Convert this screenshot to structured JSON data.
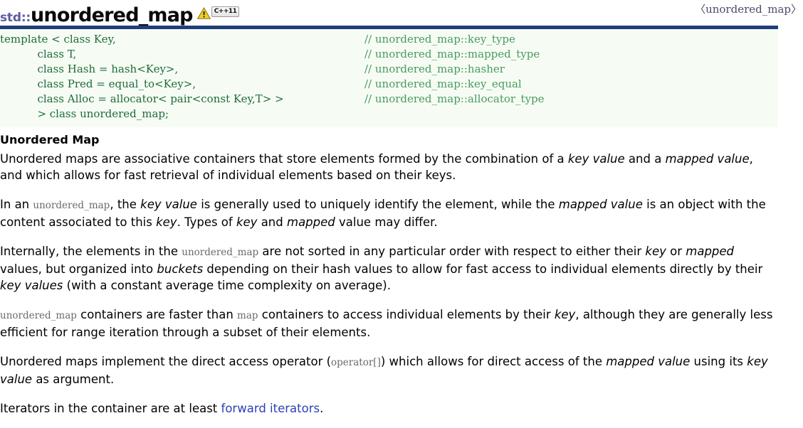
{
  "header": {
    "namespace_prefix": "std::",
    "class_name": "unordered_map",
    "warning_icon": "warning-triangle-icon",
    "standard_badge": "C++11",
    "include_header": "〈unordered_map〉"
  },
  "code_block": {
    "lines": [
      {
        "decl": "template < class Key,",
        "comment": "// unordered_map::key_type"
      },
      {
        "decl": "           class T,",
        "comment": "// unordered_map::mapped_type"
      },
      {
        "decl": "           class Hash = hash<Key>,",
        "comment": "// unordered_map::hasher"
      },
      {
        "decl": "           class Pred = equal_to<Key>,",
        "comment": "// unordered_map::key_equal"
      },
      {
        "decl": "           class Alloc = allocator< pair<const Key,T> >",
        "comment": "// unordered_map::allocator_type"
      },
      {
        "decl": "           > class unordered_map;",
        "comment": ""
      }
    ]
  },
  "content": {
    "section_title": "Unordered Map",
    "p1": {
      "t1": "Unordered maps are associative containers that store elements formed by the combination of a ",
      "em1": "key value",
      "t2": " and a ",
      "em2": "mapped value",
      "t3": ", and which allows for fast retrieval of individual elements based on their keys."
    },
    "p2": {
      "t1": "In an ",
      "code1": "unordered_map",
      "t2": ", the ",
      "em1": "key value",
      "t3": " is generally used to uniquely identify the element, while the ",
      "em2": "mapped value",
      "t4": " is an object with the content associated to this ",
      "em3": "key",
      "t5": ". Types of ",
      "em4": "key",
      "t6": " and ",
      "em5": "mapped",
      "t7": " value may differ."
    },
    "p3": {
      "t1": "Internally, the elements in the ",
      "code1": "unordered_map",
      "t2": " are not sorted in any particular order with respect to either their ",
      "em1": "key",
      "t3": " or ",
      "em2": "mapped",
      "t4": " values, but organized into ",
      "em3": "buckets",
      "t5": " depending on their hash values to allow for fast access to individual elements directly by their ",
      "em4": "key values",
      "t6": " (with a constant average time complexity on average)."
    },
    "p4": {
      "code1": "unordered_map",
      "t1": " containers are faster than ",
      "code2": "map",
      "t2": " containers to access individual elements by their ",
      "em1": "key",
      "t3": ", although they are generally less efficient for range iteration through a subset of their elements."
    },
    "p5": {
      "t1": "Unordered maps implement the direct access operator (",
      "code1": "operator[]",
      "t2": ") which allows for direct access of the ",
      "em1": "mapped value",
      "t3": " using its ",
      "em2": "key value",
      "t4": " as argument."
    },
    "p6": {
      "t1": "Iterators in the container are at least ",
      "link": "forward iterators",
      "t2": "."
    }
  },
  "colors": {
    "code_border": "#1f3f7a",
    "code_bg": "#f6fcf4",
    "code_text": "#1f6b3a",
    "comment_text": "#4a9a5e",
    "namespace_prefix": "#5b5ba5",
    "inline_code": "#6a6a6a",
    "link": "#2b3fb8"
  }
}
